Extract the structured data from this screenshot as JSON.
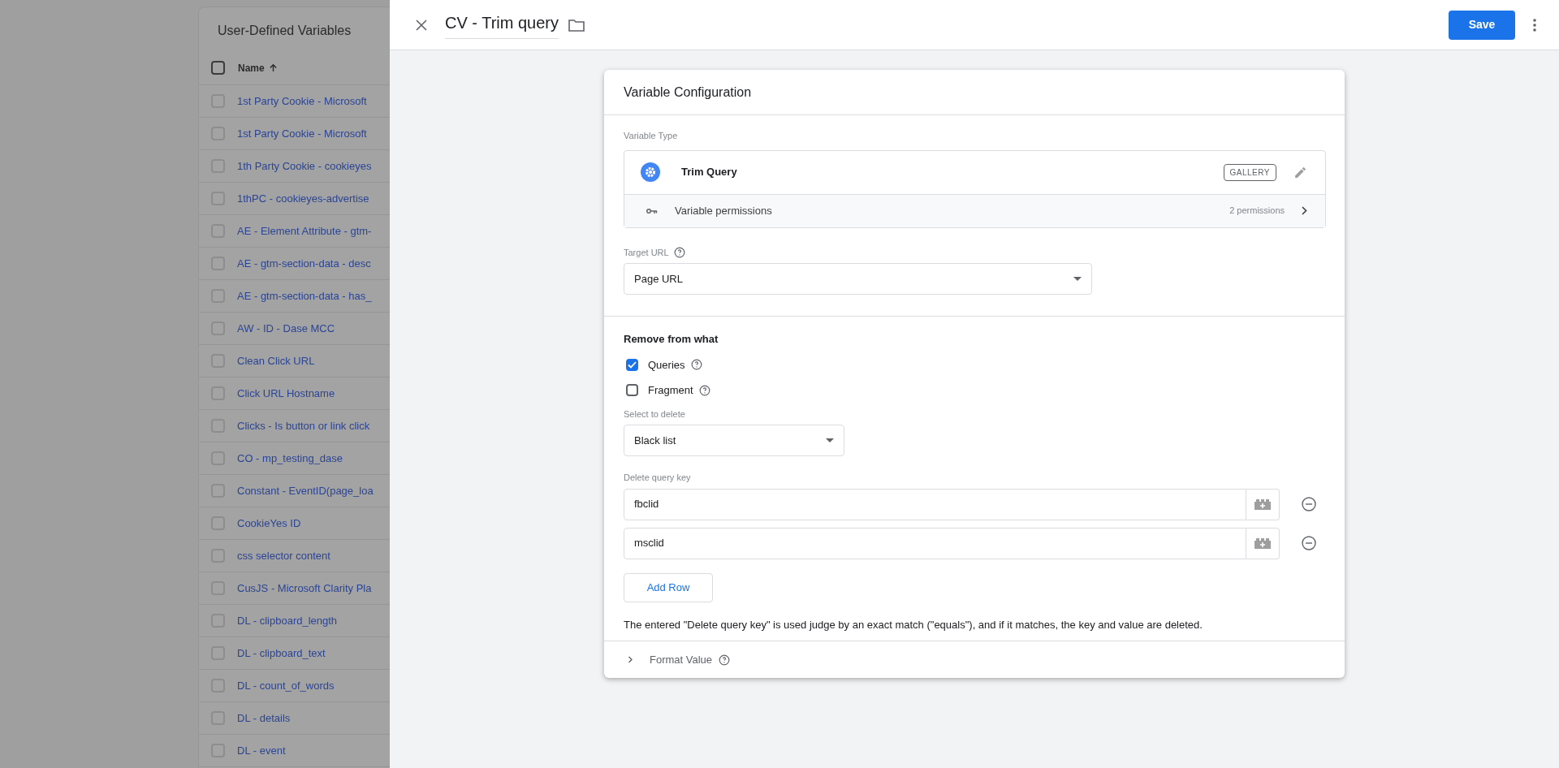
{
  "list_panel": {
    "title": "User-Defined Variables",
    "header": {
      "label": "Name",
      "checked": false
    },
    "rows": [
      {
        "name": "1st Party Cookie - Microsoft",
        "checked": false
      },
      {
        "name": "1st Party Cookie - Microsoft",
        "checked": false
      },
      {
        "name": "1th Party Cookie - cookieyes",
        "checked": false
      },
      {
        "name": "1thPC - cookieyes-advertise",
        "checked": false
      },
      {
        "name": "AE - Element Attribute - gtm-",
        "checked": false
      },
      {
        "name": "AE - gtm-section-data - desc",
        "checked": false
      },
      {
        "name": "AE - gtm-section-data - has_",
        "checked": false
      },
      {
        "name": "AW - ID - Dase MCC",
        "checked": false
      },
      {
        "name": "Clean Click URL",
        "checked": false
      },
      {
        "name": "Click URL Hostname",
        "checked": false
      },
      {
        "name": "Clicks - Is button or link click",
        "checked": false
      },
      {
        "name": "CO - mp_testing_dase",
        "checked": false
      },
      {
        "name": "Constant - EventID(page_loa",
        "checked": false
      },
      {
        "name": "CookieYes ID",
        "checked": false
      },
      {
        "name": "css selector content",
        "checked": false
      },
      {
        "name": "CusJS - Microsoft Clarity Pla",
        "checked": false
      },
      {
        "name": "DL - clipboard_length",
        "checked": false
      },
      {
        "name": "DL - clipboard_text",
        "checked": false
      },
      {
        "name": "DL - count_of_words",
        "checked": false
      },
      {
        "name": "DL - details",
        "checked": false
      },
      {
        "name": "DL - event",
        "checked": false
      }
    ]
  },
  "editor": {
    "title": "CV - Trim query",
    "save_button": "Save",
    "card": {
      "title": "Variable Configuration",
      "variable_type": {
        "label": "Variable Type",
        "name": "Trim Query",
        "badge": "GALLERY",
        "permissions_label": "Variable permissions",
        "permissions_count": "2 permissions"
      },
      "target_url": {
        "label": "Target URL",
        "value": "Page URL"
      },
      "remove_section": {
        "title": "Remove from what",
        "options": [
          {
            "label": "Queries",
            "checked": true
          },
          {
            "label": "Fragment",
            "checked": false
          }
        ]
      },
      "select_to_delete": {
        "label": "Select to delete",
        "value": "Black list"
      },
      "query_keys": {
        "label": "Delete query key",
        "rows": [
          "fbclid",
          "msclid"
        ],
        "add_button": "Add Row"
      },
      "note": "The entered \"Delete query key\" is used judge by an exact match (\"equals\"), and if it matches, the key and value are deleted.",
      "format_value": {
        "label": "Format Value",
        "expanded": false
      }
    }
  }
}
